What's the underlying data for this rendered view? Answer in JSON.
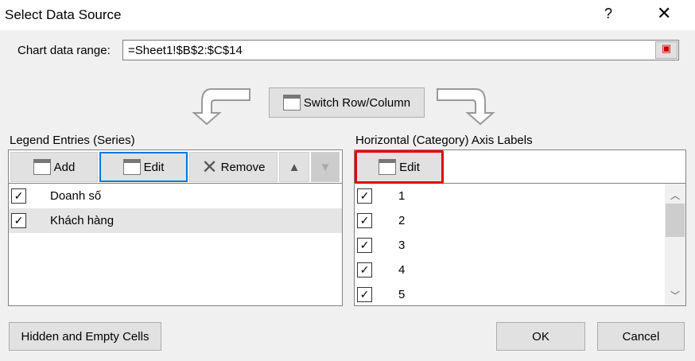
{
  "title": "Select Data Source",
  "help": "?",
  "close": "✕",
  "chart_range": {
    "label": "Chart data range:",
    "value": "=Sheet1!$B$2:$C$14"
  },
  "switch_label": "Switch Row/Column",
  "legend": {
    "label": "Legend Entries (Series)",
    "add": "Add",
    "edit": "Edit",
    "remove": "Remove",
    "items": [
      {
        "label": "Doanh số",
        "checked": true
      },
      {
        "label": "Khách hàng",
        "checked": true,
        "selected": true
      }
    ]
  },
  "axis": {
    "label": "Horizontal (Category) Axis Labels",
    "edit": "Edit",
    "items": [
      {
        "label": "1"
      },
      {
        "label": "2"
      },
      {
        "label": "3"
      },
      {
        "label": "4"
      },
      {
        "label": "5"
      }
    ]
  },
  "buttons": {
    "hidden": "Hidden and Empty Cells",
    "ok": "OK",
    "cancel": "Cancel"
  },
  "colors": {
    "highlight": "#e60000",
    "focus": "#0078d7"
  }
}
